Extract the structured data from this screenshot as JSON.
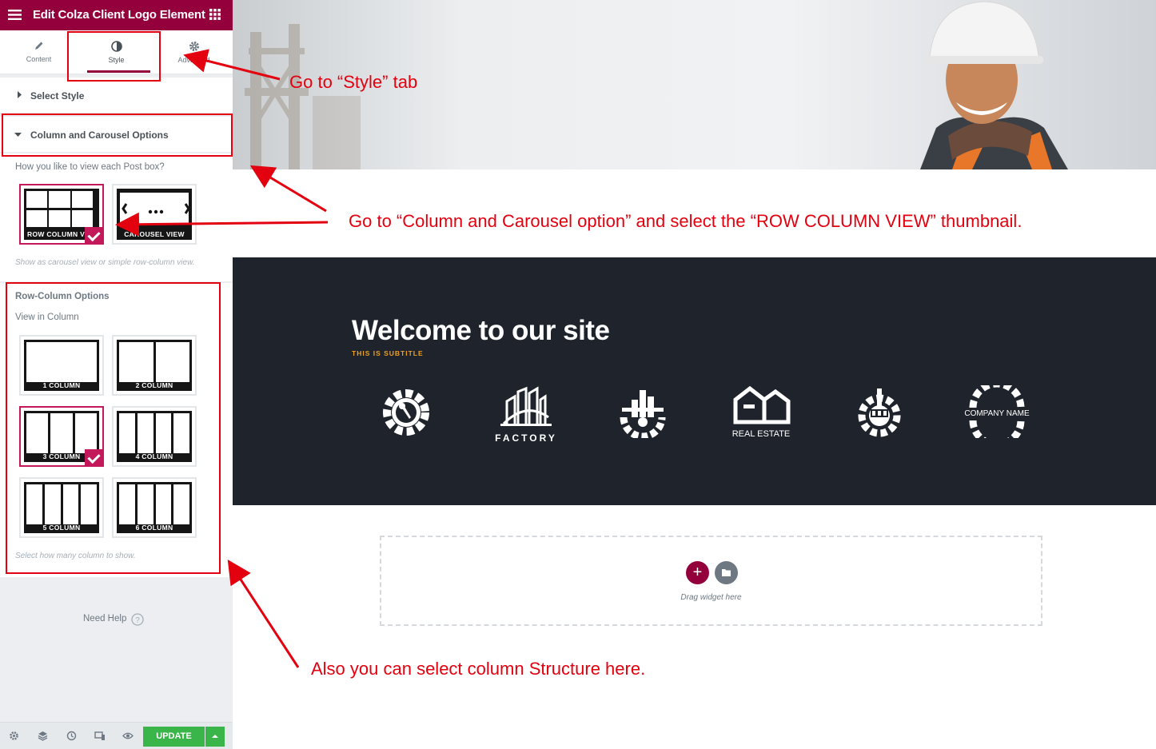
{
  "editor": {
    "title": "Edit Colza Client Logo Element",
    "tabs": [
      {
        "label": "Content",
        "icon": "pencil-icon"
      },
      {
        "label": "Style",
        "icon": "contrast-icon"
      },
      {
        "label": "Advanced",
        "icon": "gear-icon"
      }
    ],
    "active_tab": "Style",
    "section_select_style": "Select Style",
    "section_column_carousel": "Column and Carousel Options",
    "view_question": "How you like to view each Post box?",
    "view_options": [
      {
        "label": "ROW COLUMN VIEW",
        "selected": true
      },
      {
        "label": "CAROUSEL VIEW",
        "selected": false
      }
    ],
    "view_hint": "Show as carousel view or simple row-column view.",
    "row_column_title": "Row-Column Options",
    "view_in_column_label": "View in Column",
    "column_options": [
      {
        "label": "1 COLUMN",
        "cols": 1,
        "selected": false
      },
      {
        "label": "2 COLUMN",
        "cols": 2,
        "selected": false
      },
      {
        "label": "3 COLUMN",
        "cols": 3,
        "selected": true
      },
      {
        "label": "4 COLUMN",
        "cols": 4,
        "selected": false
      },
      {
        "label": "5 COLUMN",
        "cols": 4,
        "selected": false
      },
      {
        "label": "6 COLUMN",
        "cols": 4,
        "selected": false
      }
    ],
    "column_hint": "Select how many column to show.",
    "need_help": "Need Help",
    "update_label": "UPDATE"
  },
  "preview": {
    "heading": "Welcome to our site",
    "subtitle": "THIS IS SUBTITLE",
    "logos": [
      {
        "icon": "gear-wrench-icon",
        "text": ""
      },
      {
        "icon": "factory-icon",
        "text": "FACTORY"
      },
      {
        "icon": "industry-gear-icon",
        "text": ""
      },
      {
        "icon": "real-estate-icon",
        "text": "REAL ESTATE"
      },
      {
        "icon": "plant-gear-icon",
        "text": ""
      },
      {
        "icon": "company-gear-icon",
        "text": "COMPANY NAME"
      }
    ],
    "drag_widget": "Drag widget here"
  },
  "annotations": {
    "style_tab": "Go  to “Style” tab",
    "row_column_view": "Go to “Column and Carousel option” and select the “ROW COLUMN VIEW” thumbnail.",
    "column_structure": "Also you can select column Structure here."
  },
  "colors": {
    "brand": "#93003c",
    "accent": "#c3185a",
    "update": "#39b54a",
    "annotation": "#e3000f",
    "dark_section": "#1f242c"
  }
}
